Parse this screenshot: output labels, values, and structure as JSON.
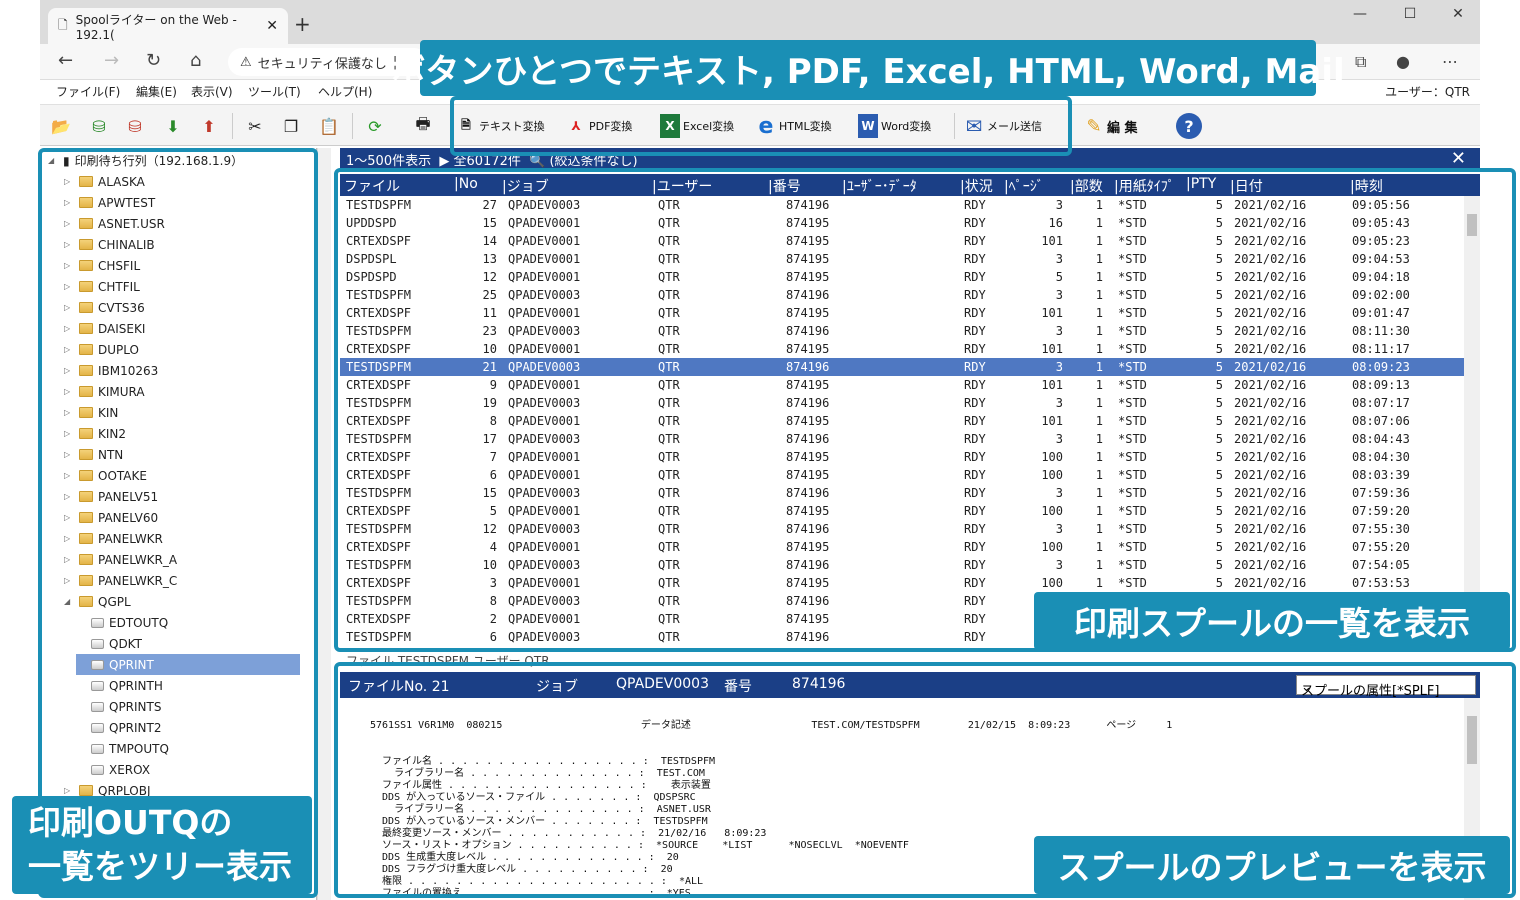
{
  "browser": {
    "tab_title": "Spoolライター on the Web - 192.1(",
    "address_security": "セキュリティ保護なし",
    "address_text": "|"
  },
  "menu": {
    "file": "ファイル(F)",
    "edit": "編集(E)",
    "view": "表示(V)",
    "tool": "ツール(T)",
    "help": "ヘルプ(H)",
    "user": "ユーザー：QTR"
  },
  "toolbar": {
    "text_conv": "テキスト変換",
    "pdf_conv": "PDF変換",
    "excel_conv": "Excel変換",
    "html_conv": "HTML変換",
    "word_conv": "Word変換",
    "mail_send": "メール送信",
    "edit": "編 集"
  },
  "tree": {
    "root": "印刷待ち行列（192.168.1.9）",
    "libraries": [
      "ALASKA",
      "APWTEST",
      "ASNET.USR",
      "CHINALIB",
      "CHSFIL",
      "CHTFIL",
      "CVTS36",
      "DAISEKI",
      "DUPLO",
      "IBM10263",
      "KIMURA",
      "KIN",
      "KIN2",
      "NTN",
      "OOTAKE",
      "PANELV51",
      "PANELV60",
      "PANELWKR",
      "PANELWKR_A",
      "PANELWKR_C",
      "QGPL"
    ],
    "outqs": [
      "EDTOUTQ",
      "QDKT",
      "QPRINT",
      "QPRINTH",
      "QPRINTS",
      "QPRINT2",
      "TMPOUTQ",
      "XEROX"
    ],
    "after": [
      "QRPLOBJ"
    ],
    "selected": "QPRINT"
  },
  "main": {
    "range": "1～500件表示",
    "total": "▶ 全60172件",
    "filter": "🔍 (絞込条件なし)",
    "columns": [
      "ファイル",
      "No",
      "ジョブ",
      "ユーザー",
      "番号",
      "ﾕｰｻﾞｰ･ﾃﾞｰﾀ",
      "状況",
      "ﾍﾟｰｼﾞ",
      "部数",
      "用紙ﾀｲﾌﾟ",
      "PTY",
      "日付",
      "時刻"
    ],
    "rows": [
      [
        "TESTDSPFM",
        "27",
        "QPADEV0003",
        "QTR",
        "874196",
        "RDY",
        "3",
        "1",
        "*STD",
        "5",
        "2021/02/16",
        "09:05:56"
      ],
      [
        "UPDDSPD",
        "15",
        "QPADEV0001",
        "QTR",
        "874195",
        "RDY",
        "16",
        "1",
        "*STD",
        "5",
        "2021/02/16",
        "09:05:43"
      ],
      [
        "CRTEXDSPF",
        "14",
        "QPADEV0001",
        "QTR",
        "874195",
        "RDY",
        "101",
        "1",
        "*STD",
        "5",
        "2021/02/16",
        "09:05:23"
      ],
      [
        "DSPDSPL",
        "13",
        "QPADEV0001",
        "QTR",
        "874195",
        "RDY",
        "3",
        "1",
        "*STD",
        "5",
        "2021/02/16",
        "09:04:53"
      ],
      [
        "DSPDSPD",
        "12",
        "QPADEV0001",
        "QTR",
        "874195",
        "RDY",
        "5",
        "1",
        "*STD",
        "5",
        "2021/02/16",
        "09:04:18"
      ],
      [
        "TESTDSPFM",
        "25",
        "QPADEV0003",
        "QTR",
        "874196",
        "RDY",
        "3",
        "1",
        "*STD",
        "5",
        "2021/02/16",
        "09:02:00"
      ],
      [
        "CRTEXDSPF",
        "11",
        "QPADEV0001",
        "QTR",
        "874195",
        "RDY",
        "101",
        "1",
        "*STD",
        "5",
        "2021/02/16",
        "09:01:47"
      ],
      [
        "TESTDSPFM",
        "23",
        "QPADEV0003",
        "QTR",
        "874196",
        "RDY",
        "3",
        "1",
        "*STD",
        "5",
        "2021/02/16",
        "08:11:30"
      ],
      [
        "CRTEXDSPF",
        "10",
        "QPADEV0001",
        "QTR",
        "874195",
        "RDY",
        "101",
        "1",
        "*STD",
        "5",
        "2021/02/16",
        "08:11:17"
      ],
      [
        "TESTDSPFM",
        "21",
        "QPADEV0003",
        "QTR",
        "874196",
        "RDY",
        "3",
        "1",
        "*STD",
        "5",
        "2021/02/16",
        "08:09:23"
      ],
      [
        "CRTEXDSPF",
        "9",
        "QPADEV0001",
        "QTR",
        "874195",
        "RDY",
        "101",
        "1",
        "*STD",
        "5",
        "2021/02/16",
        "08:09:13"
      ],
      [
        "TESTDSPFM",
        "19",
        "QPADEV0003",
        "QTR",
        "874196",
        "RDY",
        "3",
        "1",
        "*STD",
        "5",
        "2021/02/16",
        "08:07:17"
      ],
      [
        "CRTEXDSPF",
        "8",
        "QPADEV0001",
        "QTR",
        "874195",
        "RDY",
        "101",
        "1",
        "*STD",
        "5",
        "2021/02/16",
        "08:07:06"
      ],
      [
        "TESTDSPFM",
        "17",
        "QPADEV0003",
        "QTR",
        "874196",
        "RDY",
        "3",
        "1",
        "*STD",
        "5",
        "2021/02/16",
        "08:04:43"
      ],
      [
        "CRTEXDSPF",
        "7",
        "QPADEV0001",
        "QTR",
        "874195",
        "RDY",
        "100",
        "1",
        "*STD",
        "5",
        "2021/02/16",
        "08:04:30"
      ],
      [
        "CRTEXDSPF",
        "6",
        "QPADEV0001",
        "QTR",
        "874195",
        "RDY",
        "100",
        "1",
        "*STD",
        "5",
        "2021/02/16",
        "08:03:39"
      ],
      [
        "TESTDSPFM",
        "15",
        "QPADEV0003",
        "QTR",
        "874196",
        "RDY",
        "3",
        "1",
        "*STD",
        "5",
        "2021/02/16",
        "07:59:36"
      ],
      [
        "CRTEXDSPF",
        "5",
        "QPADEV0001",
        "QTR",
        "874195",
        "RDY",
        "100",
        "1",
        "*STD",
        "5",
        "2021/02/16",
        "07:59:20"
      ],
      [
        "TESTDSPFM",
        "12",
        "QPADEV0003",
        "QTR",
        "874196",
        "RDY",
        "3",
        "1",
        "*STD",
        "5",
        "2021/02/16",
        "07:55:30"
      ],
      [
        "CRTEXDSPF",
        "4",
        "QPADEV0001",
        "QTR",
        "874195",
        "RDY",
        "100",
        "1",
        "*STD",
        "5",
        "2021/02/16",
        "07:55:20"
      ],
      [
        "TESTDSPFM",
        "10",
        "QPADEV0003",
        "QTR",
        "874196",
        "RDY",
        "3",
        "1",
        "*STD",
        "5",
        "2021/02/16",
        "07:54:05"
      ],
      [
        "CRTEXDSPF",
        "3",
        "QPADEV0001",
        "QTR",
        "874195",
        "RDY",
        "100",
        "1",
        "*STD",
        "5",
        "2021/02/16",
        "07:53:53"
      ],
      [
        "TESTDSPFM",
        "8",
        "QPADEV0003",
        "QTR",
        "874196",
        "RDY",
        "",
        "",
        "",
        "",
        "",
        ""
      ],
      [
        "CRTEXDSPF",
        "2",
        "QPADEV0001",
        "QTR",
        "874195",
        "RDY",
        "",
        "",
        "",
        "",
        "",
        ""
      ],
      [
        "TESTDSPFM",
        "6",
        "QPADEV0003",
        "QTR",
        "874196",
        "RDY",
        "",
        "",
        "",
        "",
        "",
        ""
      ]
    ],
    "selected_index": 9,
    "status_line": "ファイル    TESTDSPFM      ユーザー    QTR"
  },
  "preview": {
    "file_label": "ファイルNo. 21",
    "job_label": "ジョブ",
    "job_value": "QPADEV0003",
    "number_label": "番号",
    "number_value": "874196",
    "attr_select": "スプールの属性[*SPLF]",
    "lines": [
      "5761SS1 V6R1M0  080215                       データ記述                    TEST.COM/TESTDSPFM        21/02/15  8:09:23      ページ     1",
      "",
      "  ファイル名 . . . . . . . . . . . . . . . . . :  TESTDSPFM",
      "    ライブラリー名 . . . . . . . . . . . . . . :  TEST.COM",
      "  ファイル属性 . . . . . . . . . . . . . . . . :    表示装置",
      "  DDS が入っているソース・ファイル . . . . . . . :  QDSPSRC",
      "    ライブラリー名 . . . . . . . . . . . . . . :  ASNET.USR",
      "  DDS が入っているソース・メンバー . . . . . . . :  TESTDSPFM",
      "  最終変更ソース・メンバー . . . . . . . . . . . :  21/02/16   8:09:23",
      "  ソース・リスト・オプション . . . . . . . . . . :  *SOURCE    *LIST      *NOSECLVL  *NOEVENTF",
      "  DDS 生成重大度レベル . . . . . . . . . . . . . :  20",
      "  DDS フラグづけ重大度レベル . . . . . . . . . . :  20",
      "  権限 . . . . . . . . . . . . . . . . . . . . . :  *ALL",
      "  ファイルの置換え . . . . . . . . . . . . . . . :  *YES"
    ]
  },
  "callouts": {
    "top": "ボタンひとつでテキスト, PDF, Excel, HTML, Word, Mail",
    "list": "印刷スプールの一覧を表示",
    "tree_line1": "印刷OUTQの",
    "tree_line2": "一覧をツリー表示",
    "preview": "スプールのプレビューを表示"
  },
  "colors": {
    "accent": "#1a8fb5",
    "header_blue": "#1b3f86",
    "selection": "#4f78c2"
  }
}
